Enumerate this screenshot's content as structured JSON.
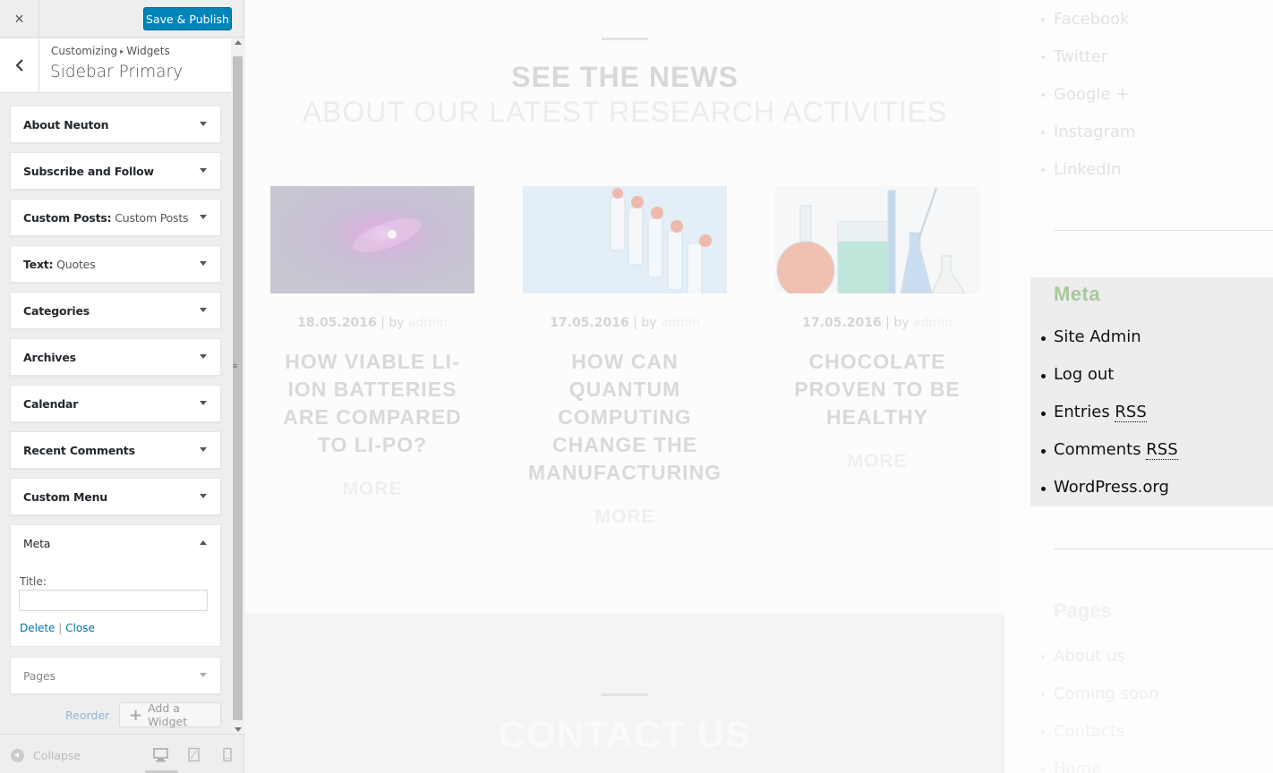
{
  "customizer": {
    "close_label": "×",
    "publish_label": "Save & Publish",
    "breadcrumb": {
      "root": "Customizing",
      "separator": "▸",
      "section": "Widgets"
    },
    "section_title": "Sidebar Primary",
    "widgets": [
      {
        "title": "About Neuton",
        "sub": "",
        "state": "collapsed"
      },
      {
        "title": "Subscribe and Follow",
        "sub": "",
        "state": "collapsed"
      },
      {
        "title": "Custom Posts:",
        "sub": " Custom Posts",
        "state": "collapsed"
      },
      {
        "title": "Text:",
        "sub": " Quotes",
        "state": "collapsed"
      },
      {
        "title": "Categories",
        "sub": "",
        "state": "collapsed"
      },
      {
        "title": "Archives",
        "sub": "",
        "state": "collapsed"
      },
      {
        "title": "Calendar",
        "sub": "",
        "state": "collapsed"
      },
      {
        "title": "Recent Comments",
        "sub": "",
        "state": "collapsed"
      },
      {
        "title": "Custom Menu",
        "sub": "",
        "state": "collapsed"
      },
      {
        "title": "Meta",
        "sub": "",
        "state": "expanded"
      },
      {
        "title": "Pages",
        "sub": "",
        "state": "disabled"
      }
    ],
    "meta_form": {
      "title_label": "Title:",
      "title_value": "",
      "delete_label": "Delete",
      "separator": "|",
      "close_label": "Close"
    },
    "reorder_label": "Reorder",
    "add_widget_label": "Add a Widget",
    "collapse_label": "Collapse",
    "accent_color": "#0085ba"
  },
  "preview": {
    "news_heading_1": "SEE THE NEWS",
    "news_heading_2": "ABOUT OUR LATEST RESEARCH ACTIVITIES",
    "by_label": "| by",
    "posts": [
      {
        "date": "18.05.2016",
        "author": "admin",
        "title": "HOW VIABLE LI-ION BATTERIES ARE COMPARED TO LI-PO?",
        "more": "MORE",
        "image": "galaxy-image"
      },
      {
        "date": "17.05.2016",
        "author": "admin",
        "title": "HOW CAN QUANTUM COMPUTING CHANGE THE MANUFACTURING",
        "more": "MORE",
        "image": "vials-image"
      },
      {
        "date": "17.05.2016",
        "author": "admin",
        "title": "CHOCOLATE PROVEN TO BE HEALTHY",
        "more": "MORE",
        "image": "flasks-image"
      }
    ],
    "contact_title": "CONTACT US",
    "social_links": [
      "Facebook",
      "Twitter",
      "Google +",
      "Instagram",
      "LinkedIn"
    ],
    "meta_widget": {
      "title": "Meta",
      "items": [
        {
          "text": "Site Admin",
          "abbr": ""
        },
        {
          "text": "Log out",
          "abbr": ""
        },
        {
          "text": "Entries ",
          "abbr": "RSS"
        },
        {
          "text": "Comments ",
          "abbr": "RSS"
        },
        {
          "text": "WordPress.org",
          "abbr": ""
        }
      ]
    },
    "pages_widget": {
      "title": "Pages",
      "items": [
        "About us",
        "Coming soon",
        "Contacts",
        "Home"
      ]
    }
  }
}
